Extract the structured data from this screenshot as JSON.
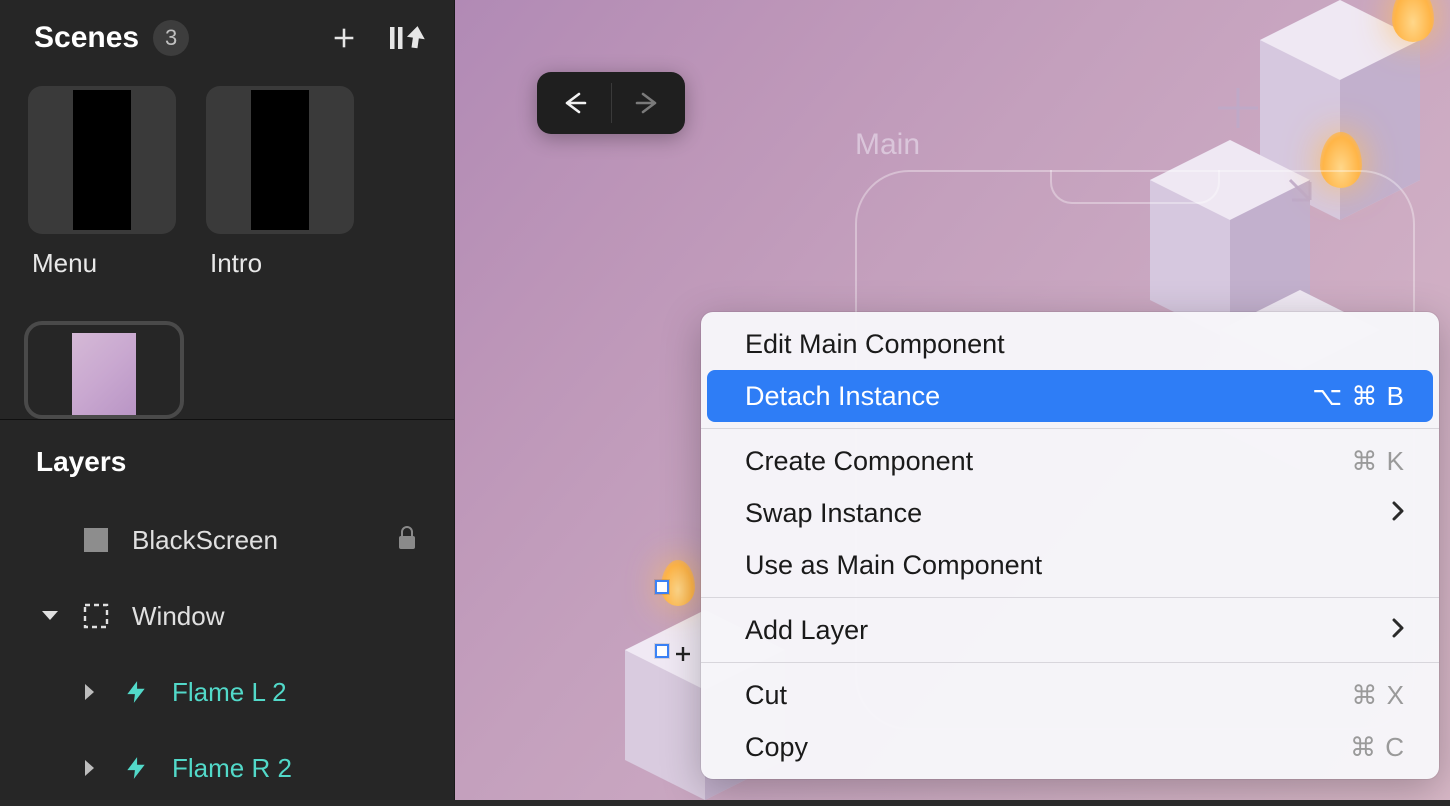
{
  "sidebar": {
    "scenes_title": "Scenes",
    "scenes_count": "3",
    "scenes": [
      {
        "label": "Menu"
      },
      {
        "label": "Intro"
      }
    ],
    "layers_title": "Layers",
    "layers": {
      "blackscreen": "BlackScreen",
      "window": "Window",
      "flame_l2": "Flame L 2",
      "flame_r2": "Flame R 2"
    }
  },
  "canvas": {
    "frame_label": "Main"
  },
  "context_menu": {
    "items": {
      "edit_main": "Edit Main Component",
      "detach": "Detach Instance",
      "detach_shortcut": "⌥ ⌘ B",
      "create_component": "Create Component",
      "create_component_shortcut": "⌘ K",
      "swap_instance": "Swap Instance",
      "use_as_main": "Use as Main Component",
      "add_layer": "Add Layer",
      "cut": "Cut",
      "cut_shortcut": "⌘ X",
      "copy": "Copy",
      "copy_shortcut": "⌘ C"
    }
  }
}
